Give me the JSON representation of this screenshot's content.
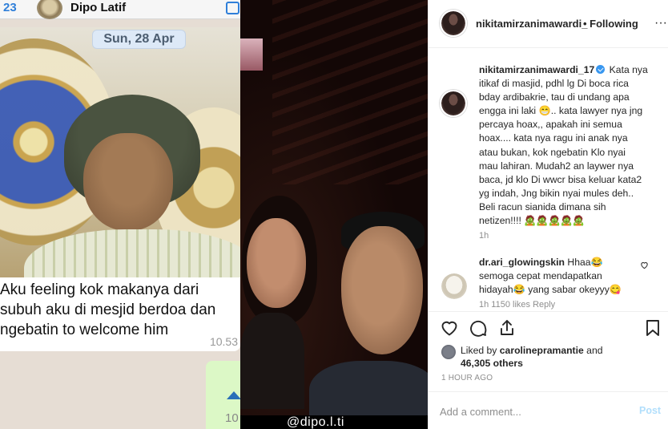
{
  "media": {
    "whatsapp": {
      "unread_count": "23",
      "contact_name": "Dipo Latif",
      "date_chip": "Sun, 28 Apr",
      "message_text": "Aku feeling kok makanya dari\nsubuh aku di mesjid berdoa dan\nngebatin to welcome him",
      "message_time": "10.53",
      "next_bubble_time": "10"
    },
    "selfie_caption": "@dipo.l.ti"
  },
  "post": {
    "author": "nikitamirzanimawardi_",
    "follow_state": "• Following",
    "more_icon": "ellipsis-icon",
    "caption": {
      "user": "nikitamirzanimawardi_17",
      "text": " Kata nya\nitikaf di masjid, pdhl lg Di boca rica\nbday ardibakrie, tau di undang apa\nengga ini laki 😁.. kata lawyer nya jng\npercaya hoax,, apakah ini semua\nhoax.... kata nya ragu ini anak nya\natau bukan, kok ngebatin Klo nyai\nmau lahiran. Mudah2 an laywer nya\nbaca, jd klo Di wwcr bisa keluar kata2\nyg indah, Jng bikin nyai mules deh..\nBeli racun sianida dimana sih\nnetizen!!!! 🧟🧟🧟🧟🧟",
      "time": "1h"
    },
    "comments": [
      {
        "user": "dr.ari_glowingskin",
        "text": " Hhaa😂\nsemoga cepat mendapatkan\nhidayah😂 yang sabar okeyyy😋",
        "meta": "1h   1150 likes   Reply"
      }
    ],
    "actions": {
      "like_icon": "heart-icon",
      "comment_icon": "comment-icon",
      "share_icon": "share-icon",
      "save_icon": "bookmark-icon"
    },
    "likes": {
      "prefix": "Liked by ",
      "user": "carolinepramantie",
      "middle": " and",
      "count": "46,305 others"
    },
    "age": "1 HOUR AGO",
    "add_comment": {
      "placeholder": "Add a comment...",
      "post_label": "Post"
    }
  },
  "colors": {
    "instagram_text": "#262626",
    "instagram_meta": "#8e8e8e",
    "verified_blue": "#3897f0",
    "post_button_disabled": "#b2dffc",
    "whatsapp_blue": "#2f7fd9"
  }
}
